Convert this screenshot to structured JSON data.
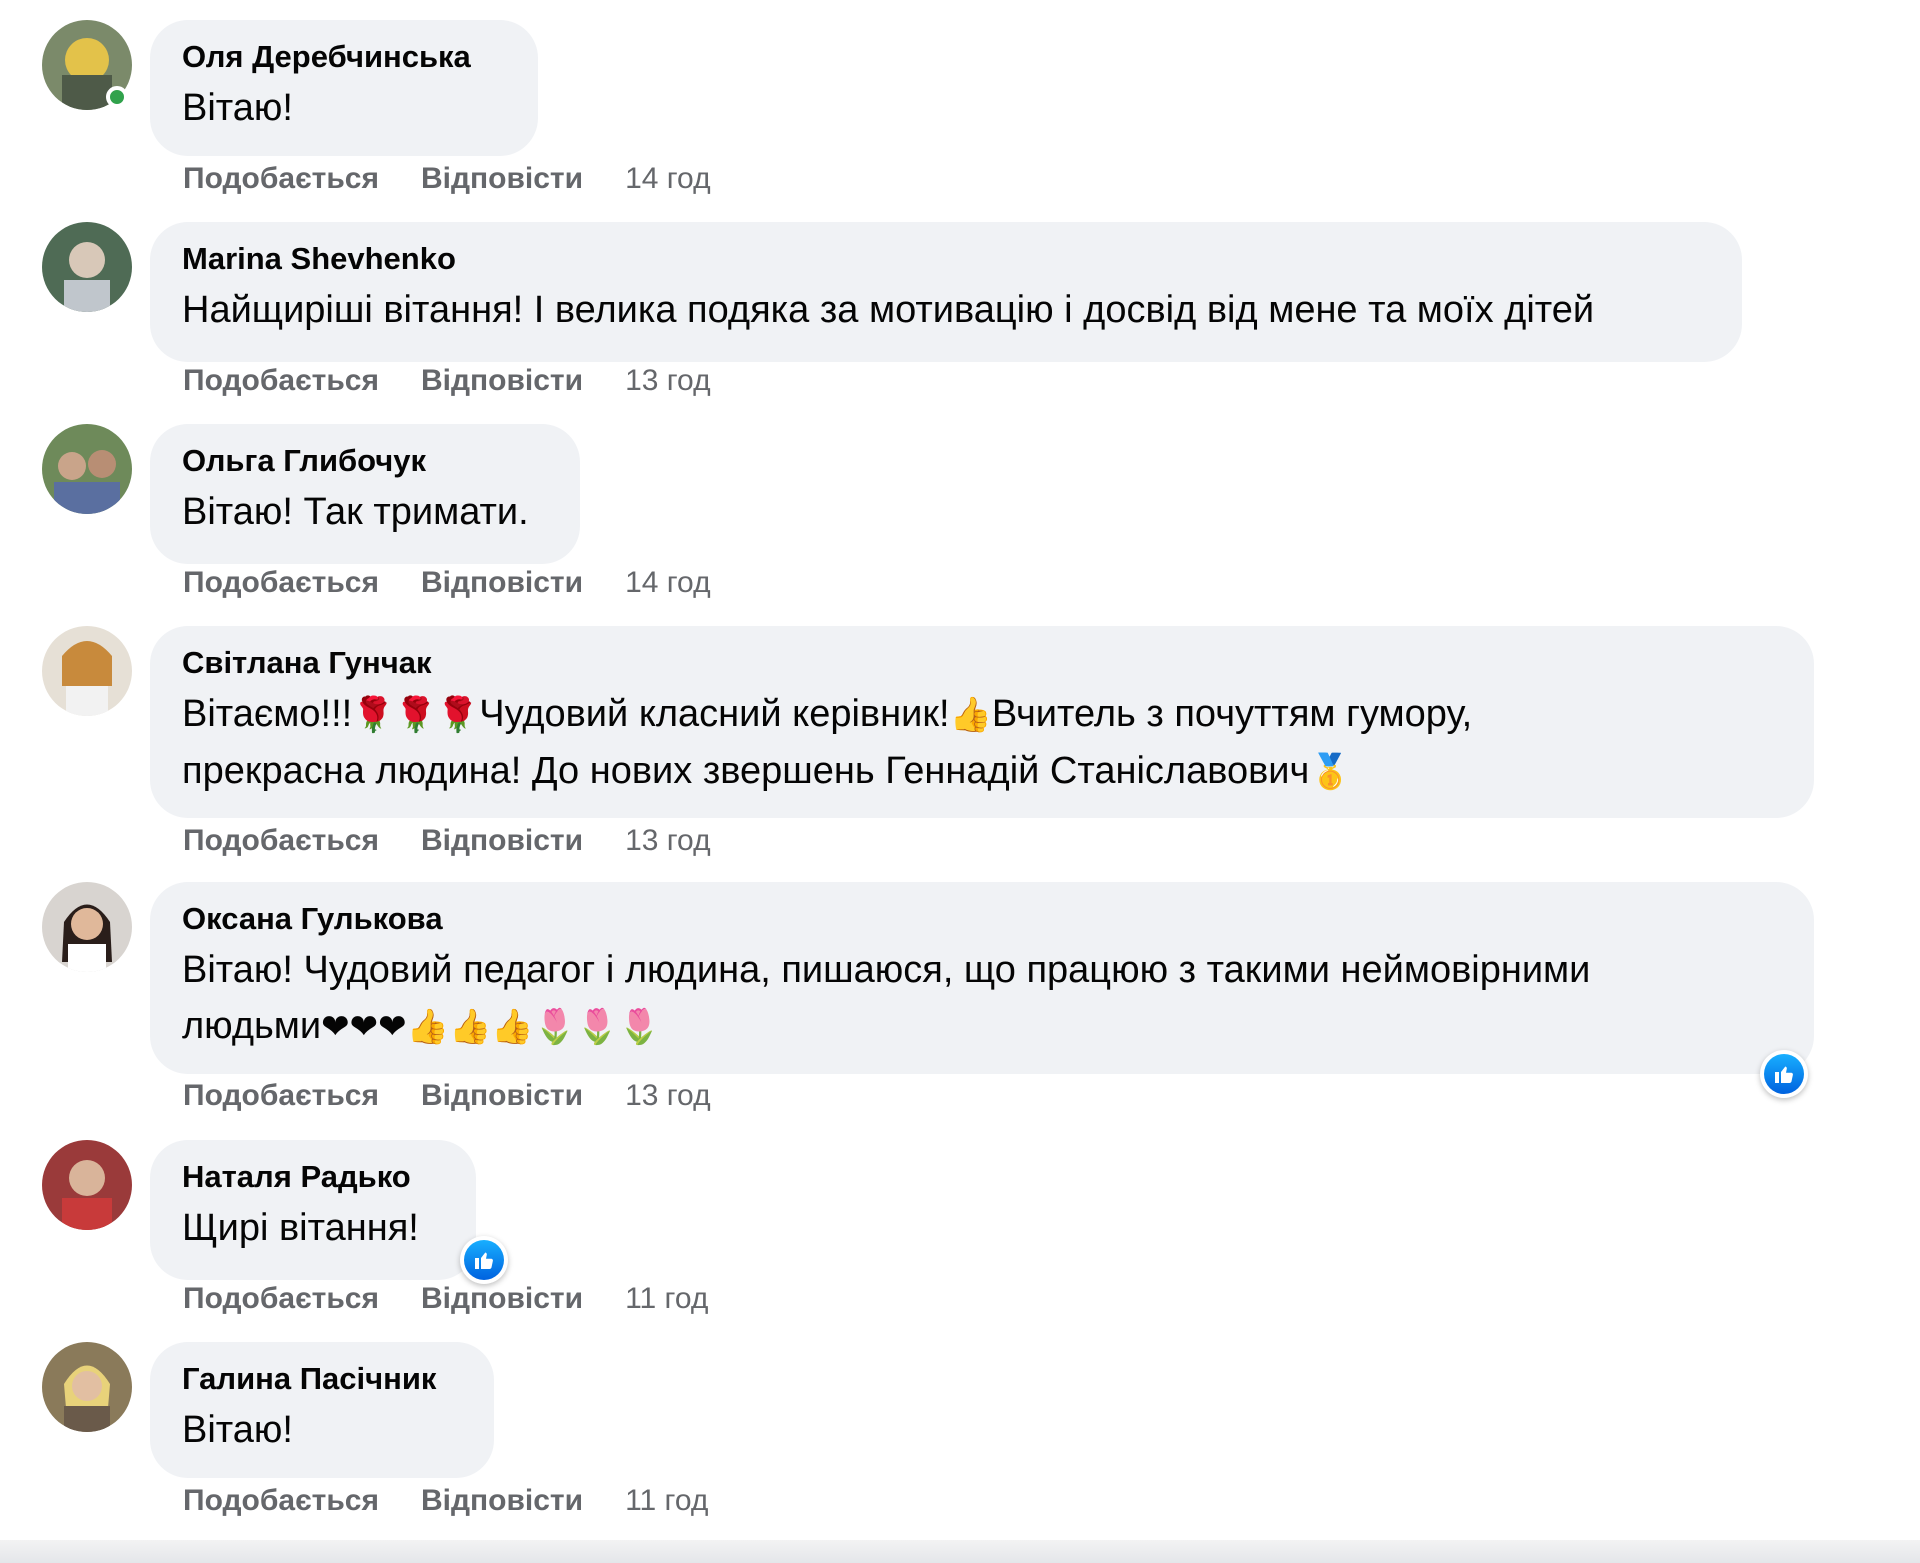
{
  "actions": {
    "like": "Подобається",
    "reply": "Відповісти"
  },
  "comments": [
    {
      "author": "Оля Деребчинська",
      "text": "Вітаю!",
      "time": "14 год"
    },
    {
      "author": "Marina Shevhenko",
      "text": "Найщиріші вітання! І велика подяка за мотивацію і досвід від мене та моїх дітей",
      "time": "13 год"
    },
    {
      "author": "Ольга Глибочук",
      "text": "Вітаю! Так тримати.",
      "time": "14 год"
    },
    {
      "author": "Світлана Гунчак",
      "text_line1_a": "Вітаємо!!!",
      "text_line1_emoji1": "🌹🌹🌹",
      "text_line1_b": "Чудовий класний керівник!",
      "text_line1_emoji2": "👍",
      "text_line1_c": "Вчитель з почуттям гумору,",
      "text_line2": "прекрасна людина! До нових звершень Геннадій Станіславович",
      "text_line2_emoji": "🥇",
      "time": "13 год"
    },
    {
      "author": "Оксана Гулькова",
      "text_line1": "Вітаю! Чудовий педагог і людина, пишаюся, що працюю з такими неймовірними",
      "text_line2": "людьми",
      "text_line2_emoji": "❤❤❤👍👍👍🌷🌷🌷",
      "time": "13 год"
    },
    {
      "author": "Наталя Радько",
      "text": "Щирі вітання!",
      "time": "11 год"
    },
    {
      "author": "Галина Пасічник",
      "text": "Вітаю!",
      "time": "11 год"
    }
  ],
  "colors": {
    "bubble": "#f0f2f5",
    "meta": "#65676b",
    "like_blue": "#1877f2",
    "online": "#31a24c"
  },
  "icons": {
    "reaction": "like-reaction-icon"
  }
}
